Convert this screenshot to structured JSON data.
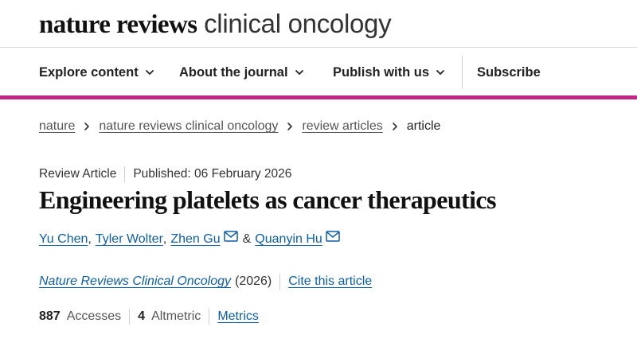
{
  "header": {
    "logo_bold": "nature reviews",
    "logo_light": "clinical oncology"
  },
  "nav": {
    "items": [
      {
        "label": "Explore content",
        "icon": "chevron-down-icon"
      },
      {
        "label": "About the journal",
        "icon": "chevron-down-icon"
      },
      {
        "label": "Publish with us",
        "icon": "chevron-down-icon"
      },
      {
        "label": "Subscribe"
      }
    ]
  },
  "breadcrumb": {
    "items": [
      "nature",
      "nature reviews clinical oncology",
      "review articles"
    ],
    "current": "article"
  },
  "article": {
    "type": "Review Article",
    "published": "Published: 06 February 2026",
    "title": "Engineering platelets as cancer therapeutics",
    "authors": [
      "Yu Chen",
      "Tyler Wolter",
      "Zhen Gu",
      "Quanyin Hu"
    ],
    "author_sep_comma": ",",
    "author_sep_and": "&",
    "journal": "Nature Reviews Clinical Oncology",
    "year": "(2026)",
    "cite_label": "Cite this article",
    "accesses_count": "887",
    "accesses_label": "Accesses",
    "altmetric_count": "4",
    "altmetric_label": "Altmetric",
    "metrics_label": "Metrics"
  },
  "colors": {
    "accent": "#c02682",
    "link": "#0d5eaa"
  }
}
